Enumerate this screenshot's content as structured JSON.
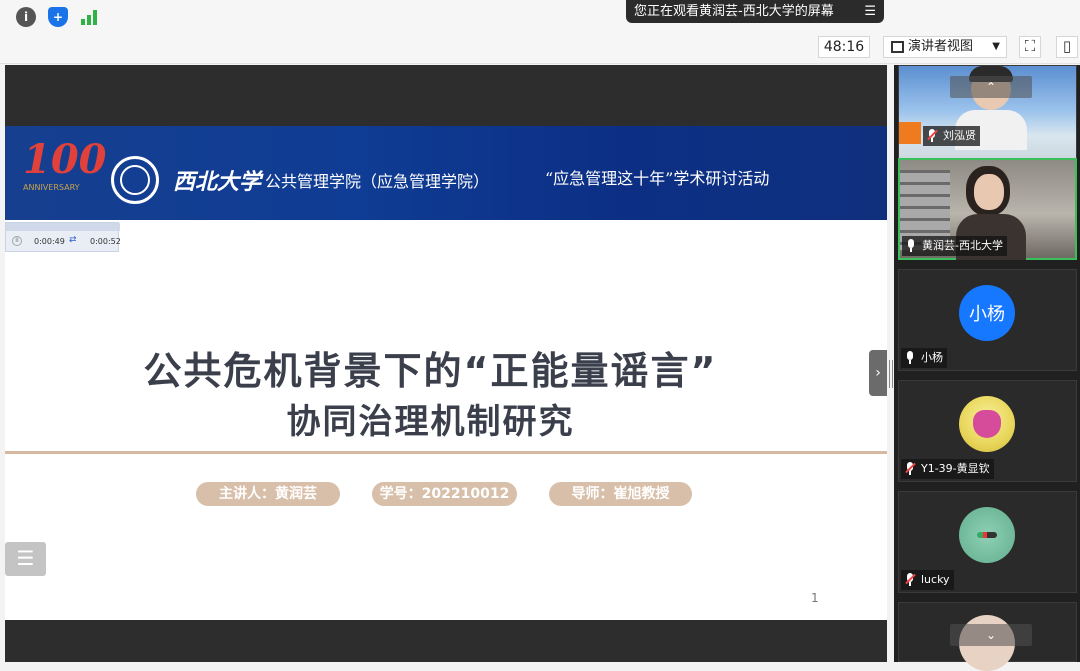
{
  "share_banner": {
    "text": "您正在观看黄润芸-西北大学的屏幕",
    "menu_icon": "menu-icon"
  },
  "toolbar": {
    "icons": [
      "info-icon",
      "shield-icon",
      "signal-icon"
    ],
    "timer": "48:16",
    "view_mode": "演讲者视图",
    "buttons": [
      "fullscreen-icon",
      "sidebar-toggle-icon"
    ]
  },
  "slide": {
    "logo_number": "100",
    "logo_sub": "ANNIVERSARY",
    "university": "西北大学",
    "school": "公共管理学院（应急管理学院）",
    "activity": "“应急管理这十年”学术研讨活动",
    "player": {
      "time_elapsed": "0:00:49",
      "time_total": "0:00:52"
    },
    "title_line1": "公共危机背景下的“正能量谣言”",
    "title_line2": "协同治理机制研究",
    "presenter": "主讲人：黄润芸",
    "student_id": "学号：202210012",
    "advisor": "导师：崔旭教授",
    "page_number": "1"
  },
  "participants": [
    {
      "name": "刘泓贤",
      "muted": true
    },
    {
      "name": "黄润芸-西北大学",
      "muted": false,
      "active": true
    },
    {
      "name": "小杨",
      "muted": false,
      "avatar_text": "小杨",
      "avatar_color": "#1677ff"
    },
    {
      "name": "Y1-39-黄显钦",
      "muted": true
    },
    {
      "name": "lucky",
      "muted": true
    },
    {
      "name": "",
      "muted": true
    }
  ]
}
